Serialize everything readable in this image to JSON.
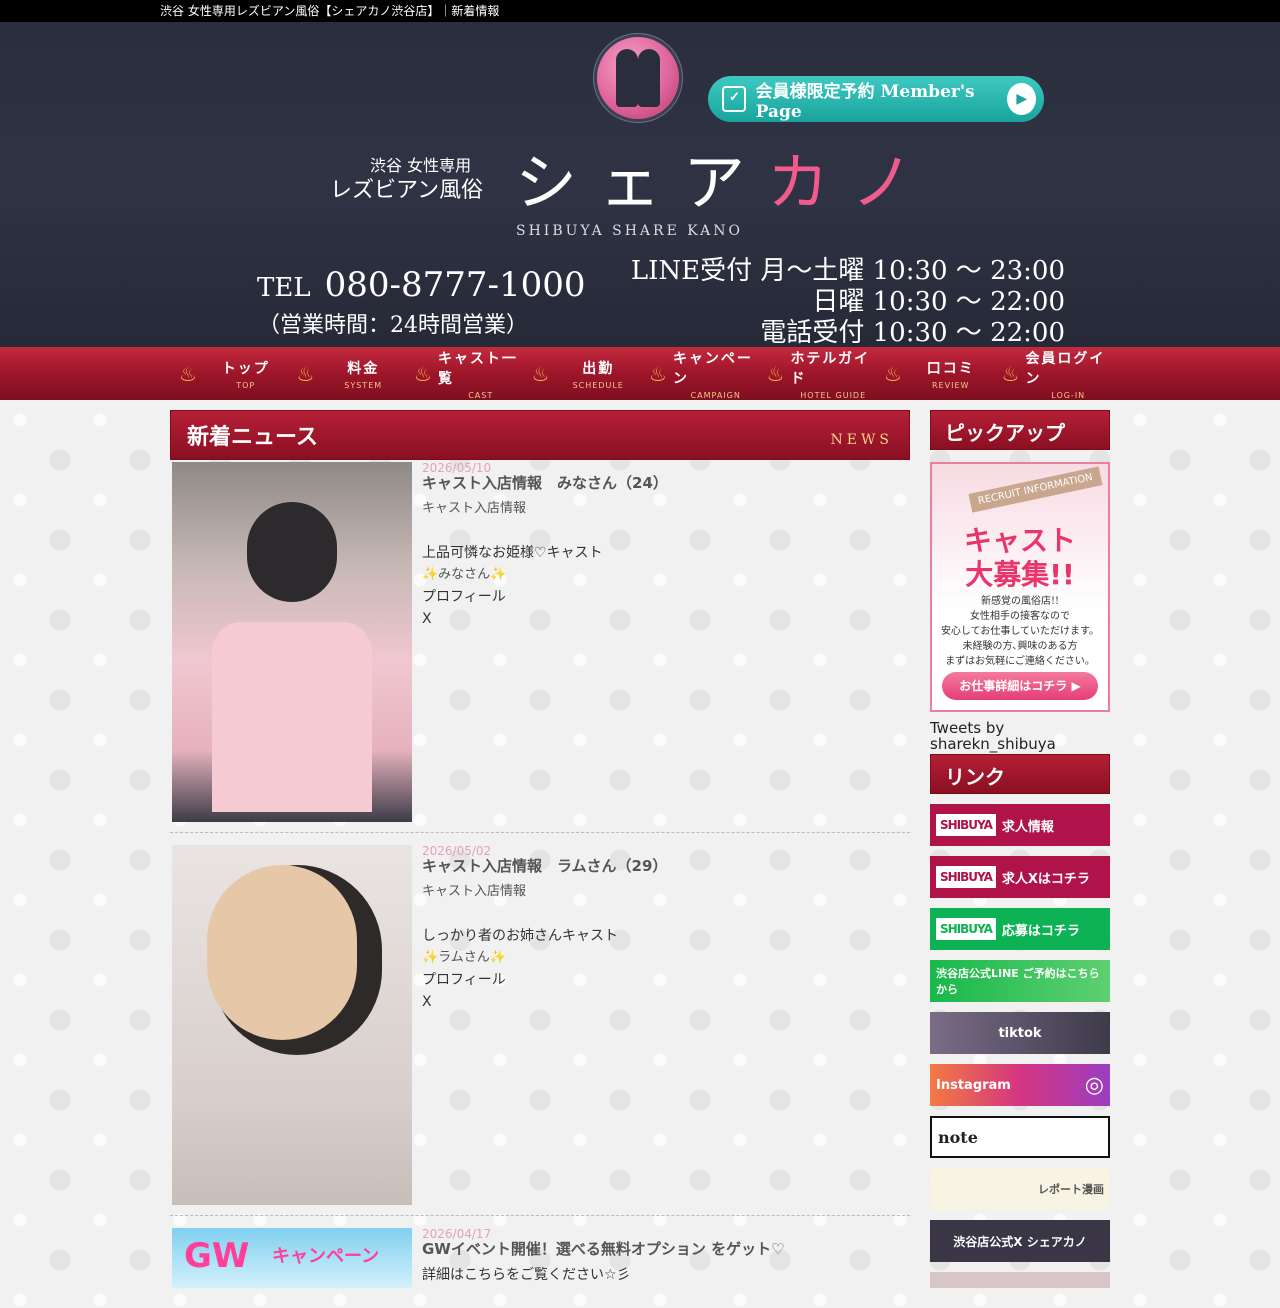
{
  "topbar": {
    "title": "渋谷 女性専用レズビアン風俗【シェアカノ渋谷店】｜新着情報"
  },
  "header": {
    "member_button": "会員様限定予約  Member's Page",
    "tagline_small": "渋谷 女性専用",
    "tagline_big": "レズビアン風俗",
    "brand_a": "シェア",
    "brand_b": "カノ",
    "brand_en": "SHIBUYA SHARE KANO",
    "tel_label": "TEL",
    "tel_number": "080-8777-1000",
    "hours": "（営業時間：24時間営業）",
    "line_1": "LINE受付  月～土曜 10:30 ～ 23:00",
    "line_2": "日曜 10:30 ～ 22:00",
    "line_3": "電話受付  10:30 ～ 22:00"
  },
  "nav": [
    {
      "jp": "トップ",
      "en": "TOP"
    },
    {
      "jp": "料金",
      "en": "SYSTEM"
    },
    {
      "jp": "キャスト一覧",
      "en": "CAST"
    },
    {
      "jp": "出勤",
      "en": "SCHEDULE"
    },
    {
      "jp": "キャンペーン",
      "en": "CAMPAIGN"
    },
    {
      "jp": "ホテルガイド",
      "en": "HOTEL GUIDE"
    },
    {
      "jp": "口コミ",
      "en": "REVIEW"
    },
    {
      "jp": "会員ログイン",
      "en": "LOG-IN"
    }
  ],
  "news_section": {
    "title": "新着ニュース",
    "label": "NEWS"
  },
  "news": [
    {
      "date": "2026/05/10",
      "title": "キャスト入店情報　みなさん（24）",
      "category": "キャスト入店情報",
      "desc": "上品可憐なお姫様♡キャスト",
      "name": "✨みなさん✨",
      "profile": "プロフィール",
      "x": "X"
    },
    {
      "date": "2026/05/02",
      "title": "キャスト入店情報　ラムさん（29）",
      "category": "キャスト入店情報",
      "desc": "しっかり者のお姉さんキャスト",
      "name": "✨ラムさん✨",
      "profile": "プロフィール",
      "x": "X"
    },
    {
      "date": "2026/04/17",
      "title": "GWイベント開催！選べる無料オプション をゲット♡",
      "detail": "詳細はこちらをご覧ください☆彡",
      "thumb_gw": "GW",
      "thumb_campaign": "キャンペーン"
    }
  ],
  "sidebar": {
    "pickup_title": "ピックアップ",
    "recruit_tag": "RECRUIT INFORMATION",
    "recruit_big_1": "キャスト",
    "recruit_big_2": "大募集!!",
    "recruit_small_1": "新感覚の風俗店!!",
    "recruit_small_2": "女性相手の接客なので",
    "recruit_small_3": "安心してお仕事していただけます。",
    "recruit_small_4": "未経験の方､興味のある方",
    "recruit_small_5": "まずはお気軽にご連絡ください。",
    "recruit_button": "お仕事詳細はコチラ ▶",
    "tweets": "Tweets by sharekn_shibuya",
    "links_title": "リンク",
    "banners": {
      "job": "求人情報",
      "job_x": "求人Xはコチラ",
      "apply": "応募はコチラ",
      "line": "渋谷店公式LINE ご予約はこちらから",
      "tiktok": "tiktok",
      "instagram": "Instagram",
      "note": "note",
      "manga": "レポート漫画",
      "x_official": "渋谷店公式X シェアカノ",
      "shibuya": "SHIBUYA"
    }
  }
}
